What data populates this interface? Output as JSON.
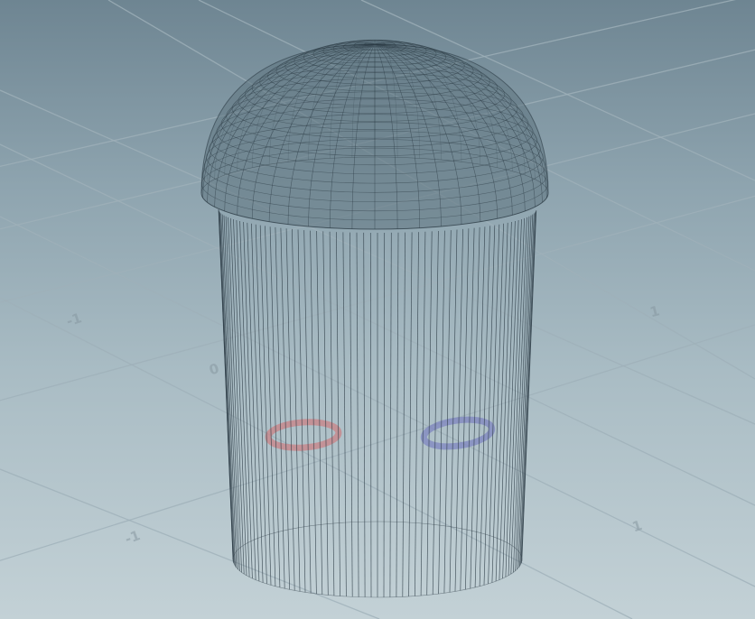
{
  "viewport": {
    "background_top": "#6e8592",
    "background_bottom": "#c3d1d6",
    "grid_color": "#9fb0b9",
    "wire_color": "#2b3a44",
    "dome_fill": "#5f7580"
  },
  "axis_labels": {
    "left_near": "-1",
    "right_near": "1",
    "left_far": "-1",
    "right_far": "1",
    "center_left": "0"
  },
  "markers": {
    "left_ring_color": "#c98286",
    "right_ring_color": "#7f86c0"
  }
}
